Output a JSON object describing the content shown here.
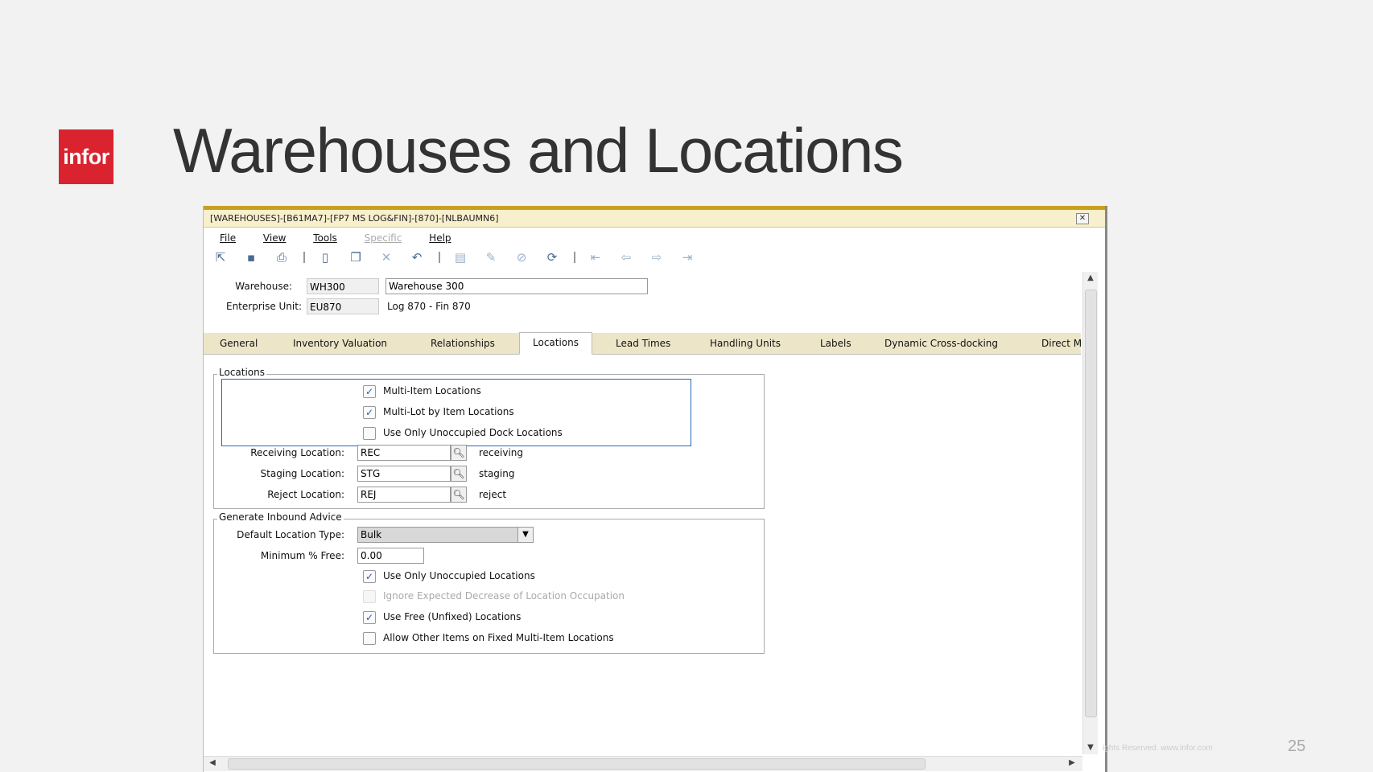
{
  "slide": {
    "logo_text": "infor",
    "title": "Warehouses and Locations",
    "footer_text": "ights Reserved. www.infor.com",
    "page_number": "25"
  },
  "window": {
    "title": "[WAREHOUSES]-[B61MA7]-[FP7 MS LOG&FIN]-[870]-[NLBAUMN6]",
    "close_label": "✕",
    "menu": [
      {
        "label": "File",
        "enabled": true
      },
      {
        "label": "View",
        "enabled": true
      },
      {
        "label": "Tools",
        "enabled": true
      },
      {
        "label": "Specific",
        "enabled": false
      },
      {
        "label": "Help",
        "enabled": true
      }
    ],
    "toolbar_icons": [
      "save-and-exit-icon",
      "save-icon",
      "print-icon",
      "new-icon",
      "duplicate-icon",
      "delete-icon",
      "undo-icon",
      "text-icon",
      "edit-icon",
      "attachment-icon",
      "refresh-icon",
      "first-record-icon",
      "previous-record-icon",
      "next-record-icon",
      "last-record-icon"
    ]
  },
  "header": {
    "warehouse_label": "Warehouse:",
    "warehouse_code": "WH300",
    "warehouse_desc": "Warehouse 300",
    "enterprise_label": "Enterprise Unit:",
    "enterprise_code": "EU870",
    "enterprise_desc": "Log 870 - Fin 870"
  },
  "tabs": [
    "General",
    "Inventory Valuation",
    "Relationships",
    "Locations",
    "Lead Times",
    "Handling Units",
    "Labels",
    "Dynamic Cross-docking",
    "Direct M"
  ],
  "active_tab": "Locations",
  "locations_group": {
    "title": "Locations",
    "checkboxes": [
      {
        "label": "Multi-Item Locations",
        "checked": true
      },
      {
        "label": "Multi-Lot by Item Locations",
        "checked": true
      },
      {
        "label": "Use Only Unoccupied Dock Locations",
        "checked": false
      }
    ],
    "receiving": {
      "label": "Receiving Location:",
      "value": "REC",
      "desc": "receiving"
    },
    "staging": {
      "label": "Staging Location:",
      "value": "STG",
      "desc": "staging"
    },
    "reject": {
      "label": "Reject Location:",
      "value": "REJ",
      "desc": "reject"
    }
  },
  "inbound_group": {
    "title": "Generate Inbound Advice",
    "default_type_label": "Default Location Type:",
    "default_type_value": "Bulk",
    "min_free_label": "Minimum % Free:",
    "min_free_value": "0.00",
    "checkboxes": [
      {
        "label": "Use Only Unoccupied Locations",
        "checked": true,
        "enabled": true
      },
      {
        "label": "Ignore Expected Decrease of Location Occupation",
        "checked": false,
        "enabled": false
      },
      {
        "label": "Use Free (Unfixed) Locations",
        "checked": true,
        "enabled": true
      },
      {
        "label": "Allow Other Items on Fixed Multi-Item Locations",
        "checked": false,
        "enabled": true
      }
    ]
  },
  "colors": {
    "brand_red": "#d9232e",
    "window_accent": "#c8a020",
    "focus_border": "#2a64b8"
  }
}
